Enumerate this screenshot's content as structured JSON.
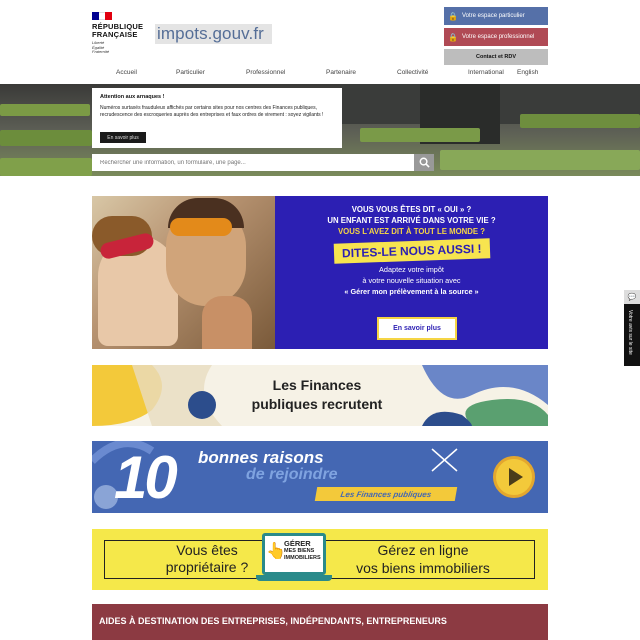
{
  "header": {
    "republic": "RÉPUBLIQUE FRANÇAISE",
    "motto": [
      "Liberté",
      "Égalité",
      "Fraternité"
    ],
    "site_logo": "impots.gouv.fr",
    "btn_particulier": "Votre espace particulier",
    "btn_professionnel": "Votre espace professionnel",
    "btn_contact": "Contact et RDV"
  },
  "nav": {
    "items": [
      "Accueil",
      "Particulier",
      "Professionnel",
      "Partenaire",
      "Collectivité",
      "International",
      "English"
    ]
  },
  "alert": {
    "title": "Attention aux arnaques !",
    "text": "Numéros surtaxés frauduleux affichés par certains sites pour nos centres des Finances publiques, recrudescence des escroqueries auprès des entreprises et faux ordres de virement : soyez vigilants !",
    "button": "En savoir plus"
  },
  "search": {
    "placeholder": "Rechercher une information, un formulaire, une page..."
  },
  "banner1": {
    "l1": "VOUS VOUS ÊTES DIT « OUI » ?",
    "l2": "UN ENFANT EST ARRIVÉ DANS VOTRE VIE ?",
    "l3": "VOUS L'AVEZ DIT À TOUT LE MONDE ?",
    "tag": "DITES-LE NOUS AUSSI !",
    "p1": "Adaptez votre impôt",
    "p2": "à votre nouvelle situation avec",
    "p3": "« Gérer mon prélèvement à la source »",
    "button": "En savoir plus"
  },
  "banner2": {
    "l1": "Les Finances",
    "l2": "publiques recrutent"
  },
  "banner3": {
    "num": "10",
    "l1": "bonnes raisons",
    "l2": "de rejoindre",
    "tag": "Les Finances publiques"
  },
  "banner4": {
    "left1": "Vous êtes",
    "left2": "propriétaire ?",
    "logo1": "GÉRER",
    "logo2": "MES BIENS",
    "logo3": "IMMOBILIERS",
    "right1": "Gérez en ligne",
    "right2": "vos biens immobiliers"
  },
  "banner5": {
    "title": "AIDES À DESTINATION DES ENTREPRISES, INDÉPENDANTS, ENTREPRENEURS"
  },
  "sidetab": {
    "label": "Votre avis sur le site"
  },
  "colors": {
    "flag_blue": "#000091",
    "flag_red": "#e1000f",
    "particulier": "#5570a8",
    "professionnel": "#b04a55",
    "campaign_blue": "#2c1fb3",
    "yellow": "#f7e44f",
    "aides_red": "#8c3a42"
  }
}
